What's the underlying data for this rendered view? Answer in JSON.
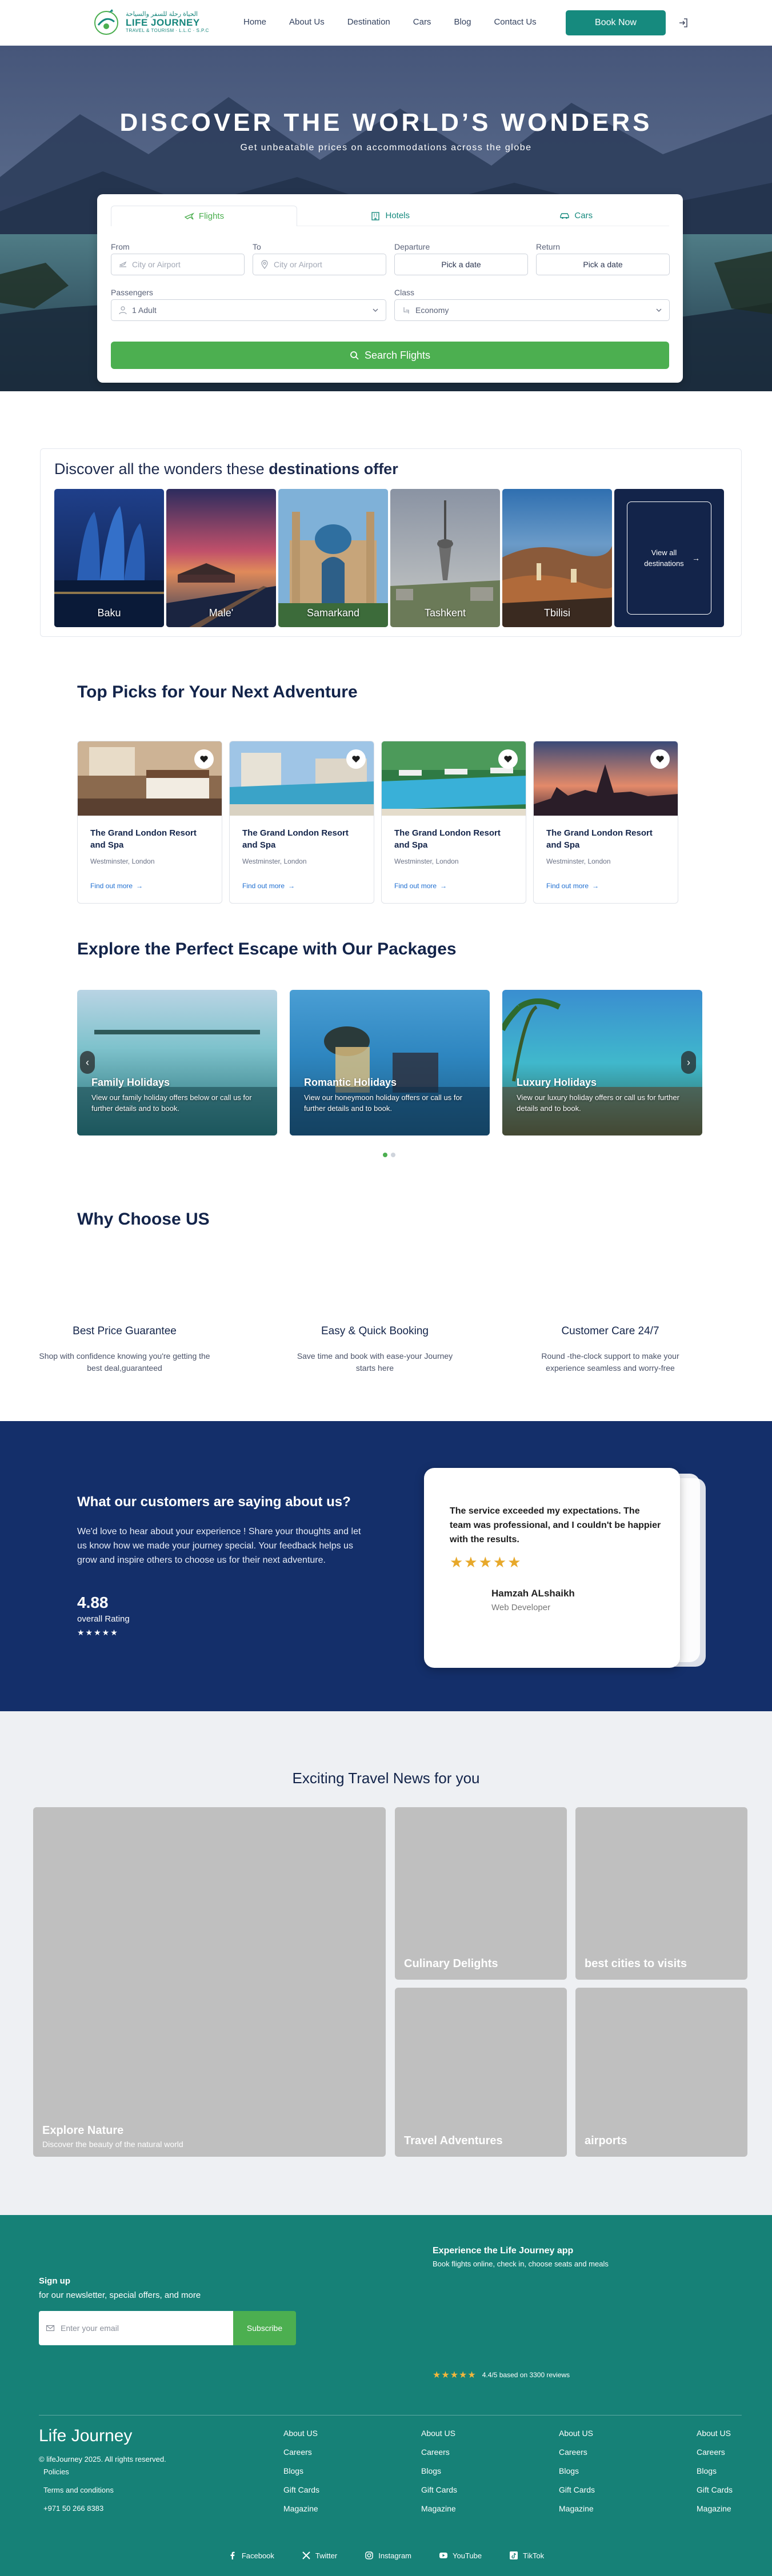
{
  "nav": {
    "logo_arabic": "الحياة رحلة للسفر والسياحة",
    "logo_name": "LIFE JOURNEY",
    "logo_sub": "TRAVEL & TOURISM · L.L.C · S.P.C",
    "menu": [
      "Home",
      "About Us",
      "Destination",
      "Cars",
      "Blog",
      "Contact Us"
    ],
    "book_now": "Book Now"
  },
  "hero": {
    "title": "DISCOVER THE WORLD’S WONDERS",
    "subtitle": "Get unbeatable prices on accommodations across the globe"
  },
  "search": {
    "tabs": [
      "Flights",
      "Hotels",
      "Cars"
    ],
    "from_label": "From",
    "from_placeholder": "City or Airport",
    "to_label": "To",
    "to_placeholder": "City or Airport",
    "departure_label": "Departure",
    "departure_value": "Pick a date",
    "return_label": "Return",
    "return_value": "Pick a date",
    "passengers_label": "Passengers",
    "passengers_value": "1 Adult",
    "class_label": "Class",
    "class_value": "Economy",
    "button": "Search Flights"
  },
  "destinations": {
    "title_prefix": "Discover all the wonders these ",
    "title_bold": "destinations offer",
    "items": [
      "Baku",
      "Male'",
      "Samarkand",
      "Tashkent",
      "Tbilisi"
    ],
    "view_all": "View all destinations"
  },
  "top_picks": {
    "title": "Top Picks for Your Next Adventure",
    "items": [
      {
        "title": "The Grand London Resort and Spa",
        "location": "Westminster, London",
        "link": "Find out more"
      },
      {
        "title": "The Grand London Resort and Spa",
        "location": "Westminster, London",
        "link": "Find out more"
      },
      {
        "title": "The Grand London Resort and Spa",
        "location": "Westminster, London",
        "link": "Find out more"
      },
      {
        "title": "The Grand London Resort and Spa",
        "location": "Westminster, London",
        "link": "Find out more"
      }
    ]
  },
  "packages": {
    "title": "Explore the Perfect Escape with Our Packages",
    "items": [
      {
        "title": "Family Holidays",
        "desc": "View our family holiday offers below or call us for further details and to book."
      },
      {
        "title": "Romantic Holidays",
        "desc": "View our honeymoon holiday offers or call us for further details and to book."
      },
      {
        "title": "Luxury Holidays",
        "desc": "View our luxury holiday offers or call us for further details and to book."
      }
    ]
  },
  "why": {
    "title": "Why Choose US",
    "items": [
      {
        "title": "Best Price Guarantee",
        "desc": "Shop with confidence knowing you're getting the best deal,guaranteed"
      },
      {
        "title": "Easy & Quick Booking",
        "desc": "Save time and book with ease-your Journey starts here"
      },
      {
        "title": "Customer Care 24/7",
        "desc": "Round -the-clock support to make your experience seamless and worry-free"
      }
    ]
  },
  "testimonials": {
    "title": "What our customers are saying about us?",
    "text": "We'd love to hear about your experience ! Share your thoughts and let us know how we made your journey special. Your feedback helps us grow and inspire others to choose us for their next adventure.",
    "rating": "4.88",
    "rating_label": "overall Rating",
    "rating_stars": "★★★★★",
    "quote": "The service exceeded my expectations. The team was professional, and I couldn't be happier with the results.",
    "quote_stars": "★★★★★",
    "name": "Hamzah ALshaikh",
    "role": "Web Developer"
  },
  "news": {
    "title": "Exciting Travel News for you",
    "featured_title": "Explore Nature",
    "featured_sub": "Discover the beauty of the natural world",
    "items": [
      "Culinary Delights",
      "best cities to visits",
      "Travel Adventures",
      "airports"
    ]
  },
  "footer": {
    "app_title": "Experience the Life Journey app",
    "app_sub": "Book flights online, check in, choose seats and meals",
    "signup_title": "Sign up",
    "signup_sub": "for our newsletter, special offers, and more",
    "email_placeholder": "Enter your email",
    "subscribe": "Subscribe",
    "rating_stars": "★★★★★",
    "rating_text": "4.4/5 based on 3300 reviews",
    "brand": "Life Journey",
    "copyright": "© lifeJourney 2025. All rights reserved.",
    "policies": "Policies",
    "terms": "Terms and conditions",
    "phone": "+971 50 266 8383",
    "col_links": [
      "About US",
      "Careers",
      "Blogs",
      "Gift Cards",
      "Magazine"
    ],
    "social": [
      "Facebook",
      "Twitter",
      "Instagram",
      "YouTube",
      "TikTok"
    ]
  },
  "colors": {
    "brand_teal": "#168a7e",
    "accent_green": "#4caf50",
    "navy": "#13244a",
    "testimonial_bg": "#142f6a",
    "star_gold": "#e7a82a"
  }
}
